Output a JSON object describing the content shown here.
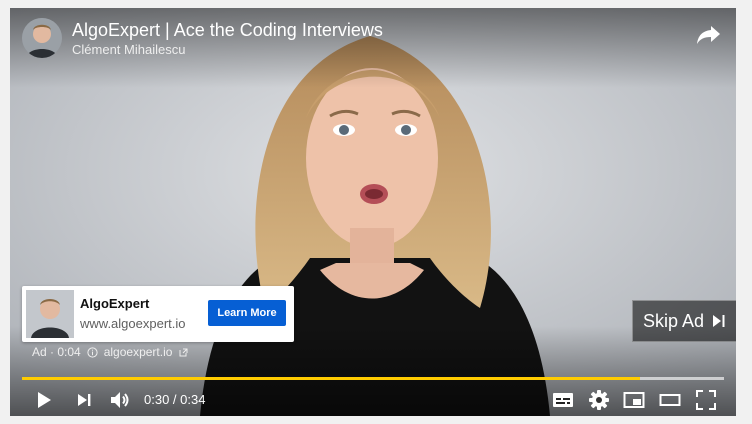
{
  "header": {
    "title": "AlgoExpert | Ace the Coding Interviews",
    "channel": "Clément Mihailescu",
    "share_icon": "share-icon"
  },
  "ad": {
    "name": "AlgoExpert",
    "url": "www.algoexpert.io",
    "cta": "Learn More",
    "label": "Ad · 0:04",
    "domain": "algoexpert.io",
    "cta_color": "#065fd4"
  },
  "skip": {
    "label": "Skip Ad",
    "icon": "skip-next-icon"
  },
  "progress": {
    "played_fraction": 0.88,
    "accent": "#ffcc00"
  },
  "player": {
    "current_time": "0:30",
    "separator": " / ",
    "duration": "0:34"
  },
  "controls": {
    "icons": [
      "play-icon",
      "next-icon",
      "volume-icon",
      "subtitles-icon",
      "settings-icon",
      "miniplayer-icon",
      "theater-icon",
      "fullscreen-icon"
    ]
  }
}
